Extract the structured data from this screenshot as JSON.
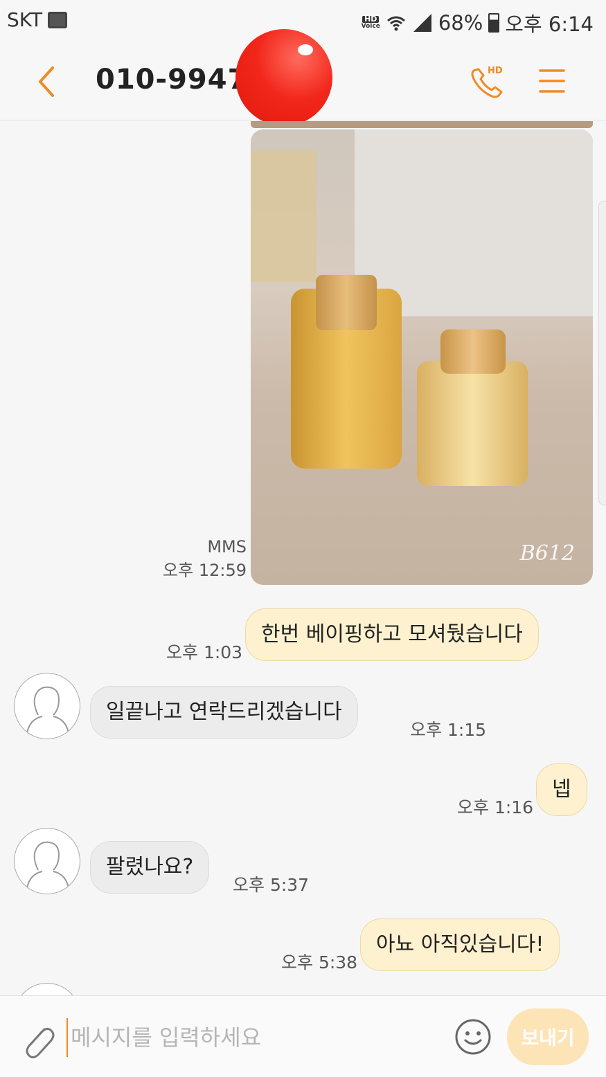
{
  "status_bar": {
    "carrier": "SKT",
    "hd_top": "HD",
    "hd_bottom": "Voice",
    "battery": "68%",
    "clock": "오후 6:14"
  },
  "header": {
    "contact_number": "010-9947-",
    "call_badge": "HD"
  },
  "messages": {
    "mms_label": "MMS",
    "mms_time": "오후 12:59",
    "m1": {
      "text": "한번 베이핑하고 모셔뒀습니다",
      "time": "오후 1:03"
    },
    "m2": {
      "text": "일끝나고 연락드리겠습니다",
      "time": "오후 1:15"
    },
    "m3": {
      "text": "넵",
      "time": "오후 1:16"
    },
    "m4": {
      "text": "팔렸나요?",
      "time": "오후 5:37"
    },
    "m5": {
      "text": "아뇨 아직있습니다!",
      "time": "오후 5:38"
    }
  },
  "photo_watermark": "B612",
  "composer": {
    "placeholder": "메시지를 입력하세요",
    "send_label": "보내기"
  },
  "colors": {
    "accent": "#f08a24",
    "outgoing_bubble": "#fdf1cf",
    "incoming_bubble": "#ececec",
    "send_button": "#fde4b7"
  }
}
